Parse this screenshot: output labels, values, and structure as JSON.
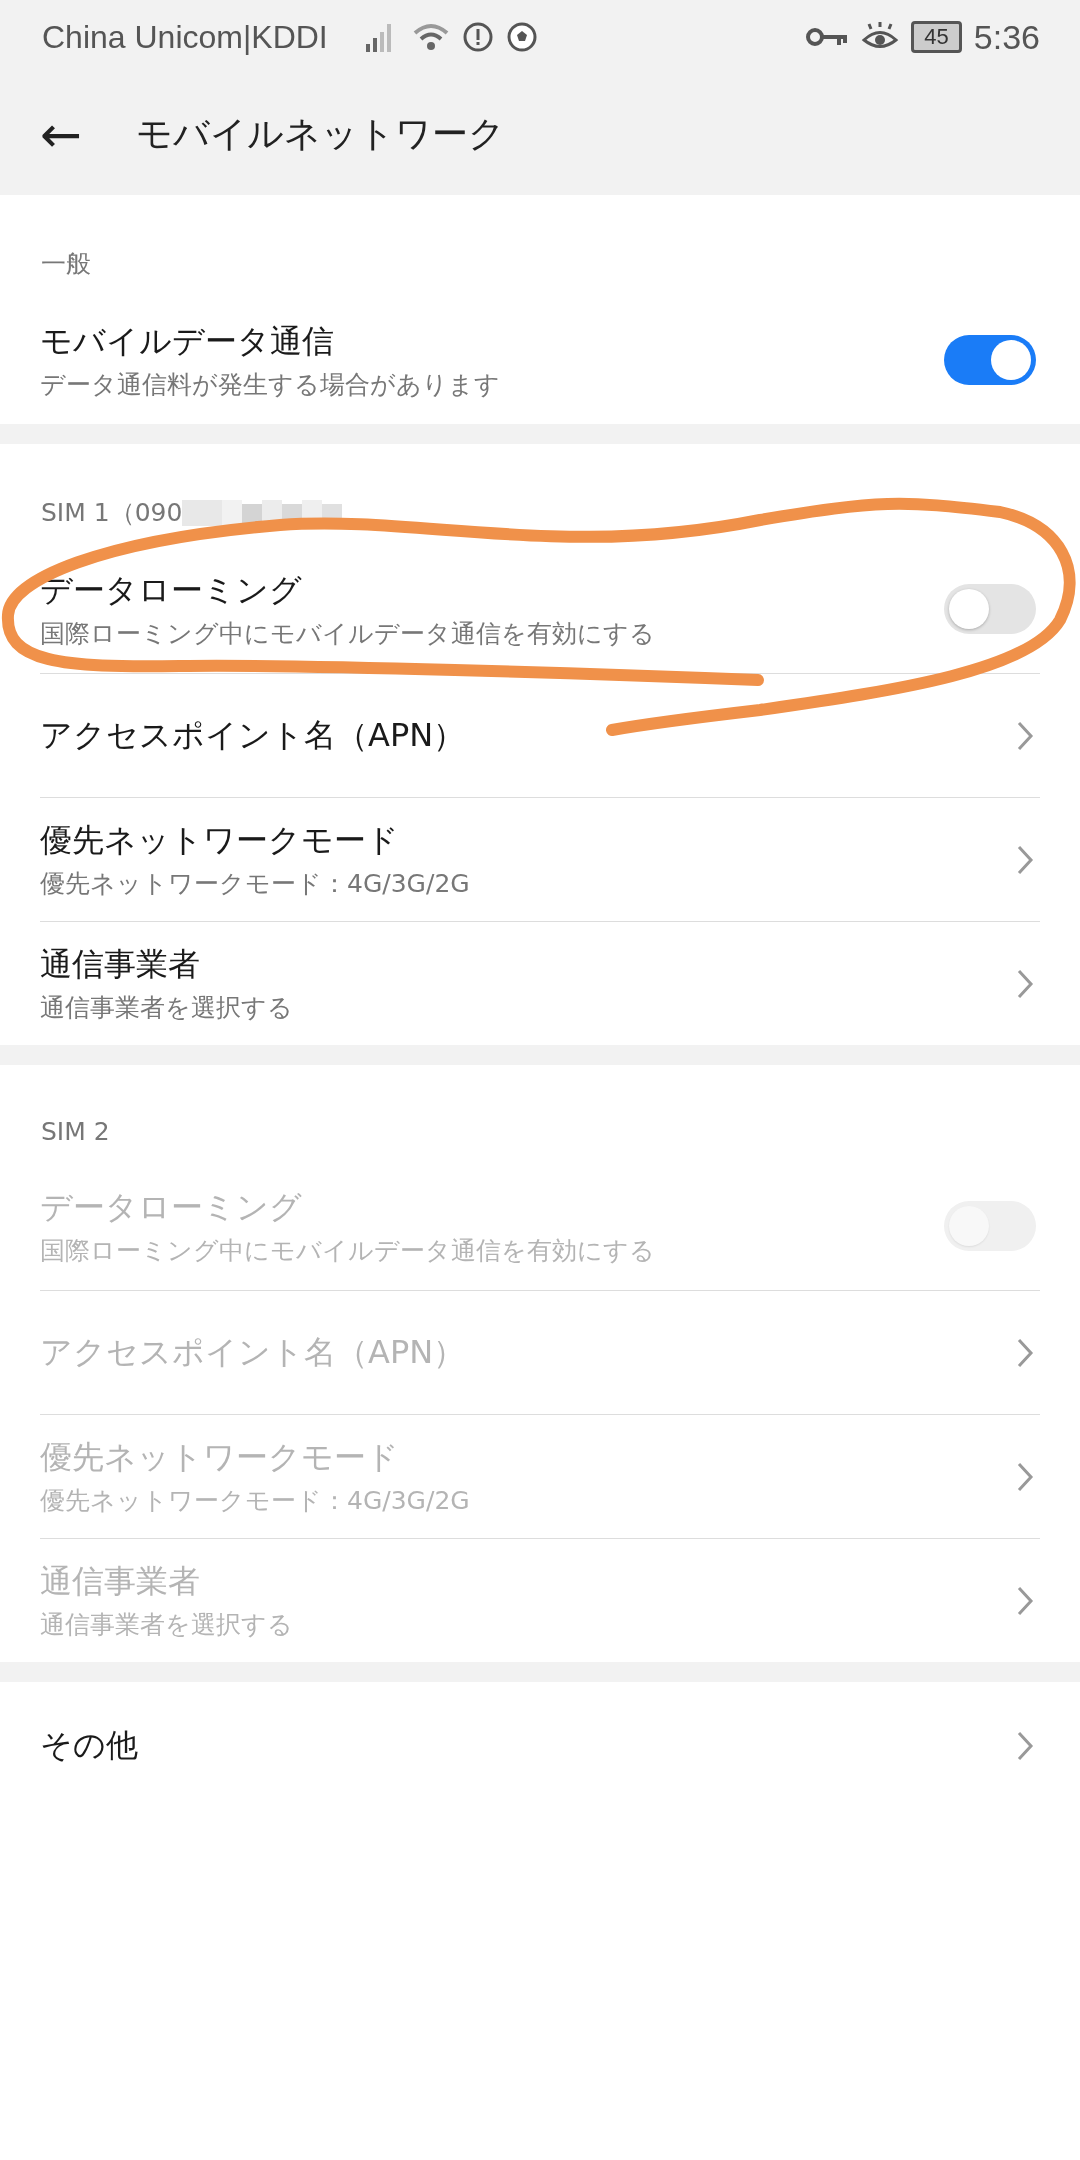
{
  "status_bar": {
    "carrier": "China Unicom|KDDI",
    "battery": "45",
    "time": "5:36"
  },
  "app_bar": {
    "back": "←",
    "title": "モバイルネットワーク"
  },
  "sections": [
    {
      "header": "一般",
      "items": [
        {
          "kind": "toggle",
          "title": "モバイルデータ通信",
          "subtitle": "データ通信料が発生する場合があります",
          "on": true,
          "disabled": false
        }
      ]
    },
    {
      "header": "SIM 1（090",
      "redacted": true,
      "items": [
        {
          "kind": "toggle",
          "title": "データローミング",
          "subtitle": "国際ローミング中にモバイルデータ通信を有効にする",
          "on": false,
          "disabled": false
        },
        {
          "kind": "link",
          "title": "アクセスポイント名（APN）",
          "disabled": false
        },
        {
          "kind": "link",
          "title": "優先ネットワークモード",
          "subtitle": "優先ネットワークモード：4G/3G/2G",
          "disabled": false
        },
        {
          "kind": "link",
          "title": "通信事業者",
          "subtitle": "通信事業者を選択する",
          "disabled": false
        }
      ]
    },
    {
      "header": "SIM 2",
      "items": [
        {
          "kind": "toggle",
          "title": "データローミング",
          "subtitle": "国際ローミング中にモバイルデータ通信を有効にする",
          "on": false,
          "disabled": true
        },
        {
          "kind": "link",
          "title": "アクセスポイント名（APN）",
          "disabled": true
        },
        {
          "kind": "link",
          "title": "優先ネットワークモード",
          "subtitle": "優先ネットワークモード：4G/3G/2G",
          "disabled": true
        },
        {
          "kind": "link",
          "title": "通信事業者",
          "subtitle": "通信事業者を選択する",
          "disabled": true
        }
      ]
    },
    {
      "items": [
        {
          "kind": "link",
          "title": "その他",
          "disabled": false
        }
      ]
    }
  ]
}
